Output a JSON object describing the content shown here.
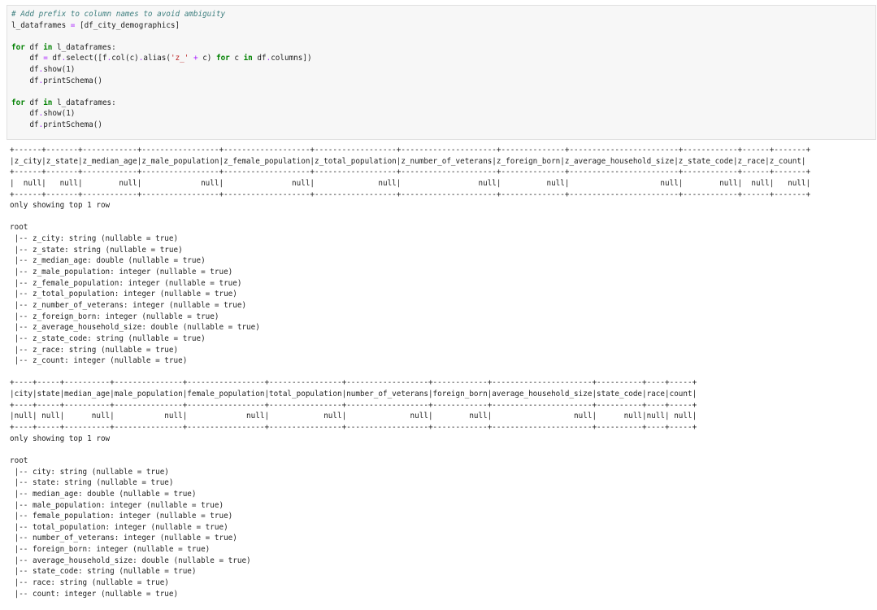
{
  "code_cell": {
    "lines": [
      {
        "segments": [
          {
            "t": "# Add prefix to column names to avoid ambiguity",
            "c": "cmt"
          }
        ]
      },
      {
        "segments": [
          {
            "t": "l_dataframes ",
            "c": ""
          },
          {
            "t": "=",
            "c": "op"
          },
          {
            "t": " [df_city_demographics]",
            "c": ""
          }
        ]
      },
      {
        "segments": [
          {
            "t": "",
            "c": ""
          }
        ]
      },
      {
        "segments": [
          {
            "t": "for",
            "c": "kw"
          },
          {
            "t": " df ",
            "c": ""
          },
          {
            "t": "in",
            "c": "kw"
          },
          {
            "t": " l_dataframes:",
            "c": ""
          }
        ]
      },
      {
        "segments": [
          {
            "t": "    df ",
            "c": ""
          },
          {
            "t": "=",
            "c": "op"
          },
          {
            "t": " df",
            "c": ""
          },
          {
            "t": ".",
            "c": "op"
          },
          {
            "t": "select([f",
            "c": ""
          },
          {
            "t": ".",
            "c": "op"
          },
          {
            "t": "col(c)",
            "c": ""
          },
          {
            "t": ".",
            "c": "op"
          },
          {
            "t": "alias(",
            "c": ""
          },
          {
            "t": "'z_'",
            "c": "str"
          },
          {
            "t": " ",
            "c": ""
          },
          {
            "t": "+",
            "c": "op"
          },
          {
            "t": " c) ",
            "c": ""
          },
          {
            "t": "for",
            "c": "kw"
          },
          {
            "t": " c ",
            "c": ""
          },
          {
            "t": "in",
            "c": "kw"
          },
          {
            "t": " df",
            "c": ""
          },
          {
            "t": ".",
            "c": "op"
          },
          {
            "t": "columns])",
            "c": ""
          }
        ]
      },
      {
        "segments": [
          {
            "t": "    df",
            "c": ""
          },
          {
            "t": ".",
            "c": "op"
          },
          {
            "t": "show(1)",
            "c": ""
          }
        ]
      },
      {
        "segments": [
          {
            "t": "    df",
            "c": ""
          },
          {
            "t": ".",
            "c": "op"
          },
          {
            "t": "printSchema()",
            "c": ""
          }
        ]
      },
      {
        "segments": [
          {
            "t": "",
            "c": ""
          }
        ]
      },
      {
        "segments": [
          {
            "t": "for",
            "c": "kw"
          },
          {
            "t": " df ",
            "c": ""
          },
          {
            "t": "in",
            "c": "kw"
          },
          {
            "t": " l_dataframes:",
            "c": ""
          }
        ]
      },
      {
        "segments": [
          {
            "t": "    df",
            "c": ""
          },
          {
            "t": ".",
            "c": "op"
          },
          {
            "t": "show(1)",
            "c": ""
          }
        ]
      },
      {
        "segments": [
          {
            "t": "    df",
            "c": ""
          },
          {
            "t": ".",
            "c": "op"
          },
          {
            "t": "printSchema()",
            "c": ""
          }
        ]
      }
    ]
  },
  "output": {
    "lines": [
      "+------+-------+------------+-----------------+-------------------+------------------+---------------------+--------------+------------------------+------------+------+-------+",
      "|z_city|z_state|z_median_age|z_male_population|z_female_population|z_total_population|z_number_of_veterans|z_foreign_born|z_average_household_size|z_state_code|z_race|z_count|",
      "+------+-------+------------+-----------------+-------------------+------------------+---------------------+--------------+------------------------+------------+------+-------+",
      "|  null|   null|        null|             null|               null|              null|                 null|          null|                    null|        null|  null|   null|",
      "+------+-------+------------+-----------------+-------------------+------------------+---------------------+--------------+------------------------+------------+------+-------+",
      "only showing top 1 row",
      "",
      "root",
      " |-- z_city: string (nullable = true)",
      " |-- z_state: string (nullable = true)",
      " |-- z_median_age: double (nullable = true)",
      " |-- z_male_population: integer (nullable = true)",
      " |-- z_female_population: integer (nullable = true)",
      " |-- z_total_population: integer (nullable = true)",
      " |-- z_number_of_veterans: integer (nullable = true)",
      " |-- z_foreign_born: integer (nullable = true)",
      " |-- z_average_household_size: double (nullable = true)",
      " |-- z_state_code: string (nullable = true)",
      " |-- z_race: string (nullable = true)",
      " |-- z_count: integer (nullable = true)",
      "",
      "+----+-----+----------+---------------+-----------------+----------------+------------------+------------+----------------------+----------+----+-----+",
      "|city|state|median_age|male_population|female_population|total_population|number_of_veterans|foreign_born|average_household_size|state_code|race|count|",
      "+----+-----+----------+---------------+-----------------+----------------+------------------+------------+----------------------+----------+----+-----+",
      "|null| null|      null|           null|             null|            null|              null|        null|                  null|      null|null| null|",
      "+----+-----+----------+---------------+-----------------+----------------+------------------+------------+----------------------+----------+----+-----+",
      "only showing top 1 row",
      "",
      "root",
      " |-- city: string (nullable = true)",
      " |-- state: string (nullable = true)",
      " |-- median_age: double (nullable = true)",
      " |-- male_population: integer (nullable = true)",
      " |-- female_population: integer (nullable = true)",
      " |-- total_population: integer (nullable = true)",
      " |-- number_of_veterans: integer (nullable = true)",
      " |-- foreign_born: integer (nullable = true)",
      " |-- average_household_size: double (nullable = true)",
      " |-- state_code: string (nullable = true)",
      " |-- race: string (nullable = true)",
      " |-- count: integer (nullable = true)"
    ]
  }
}
